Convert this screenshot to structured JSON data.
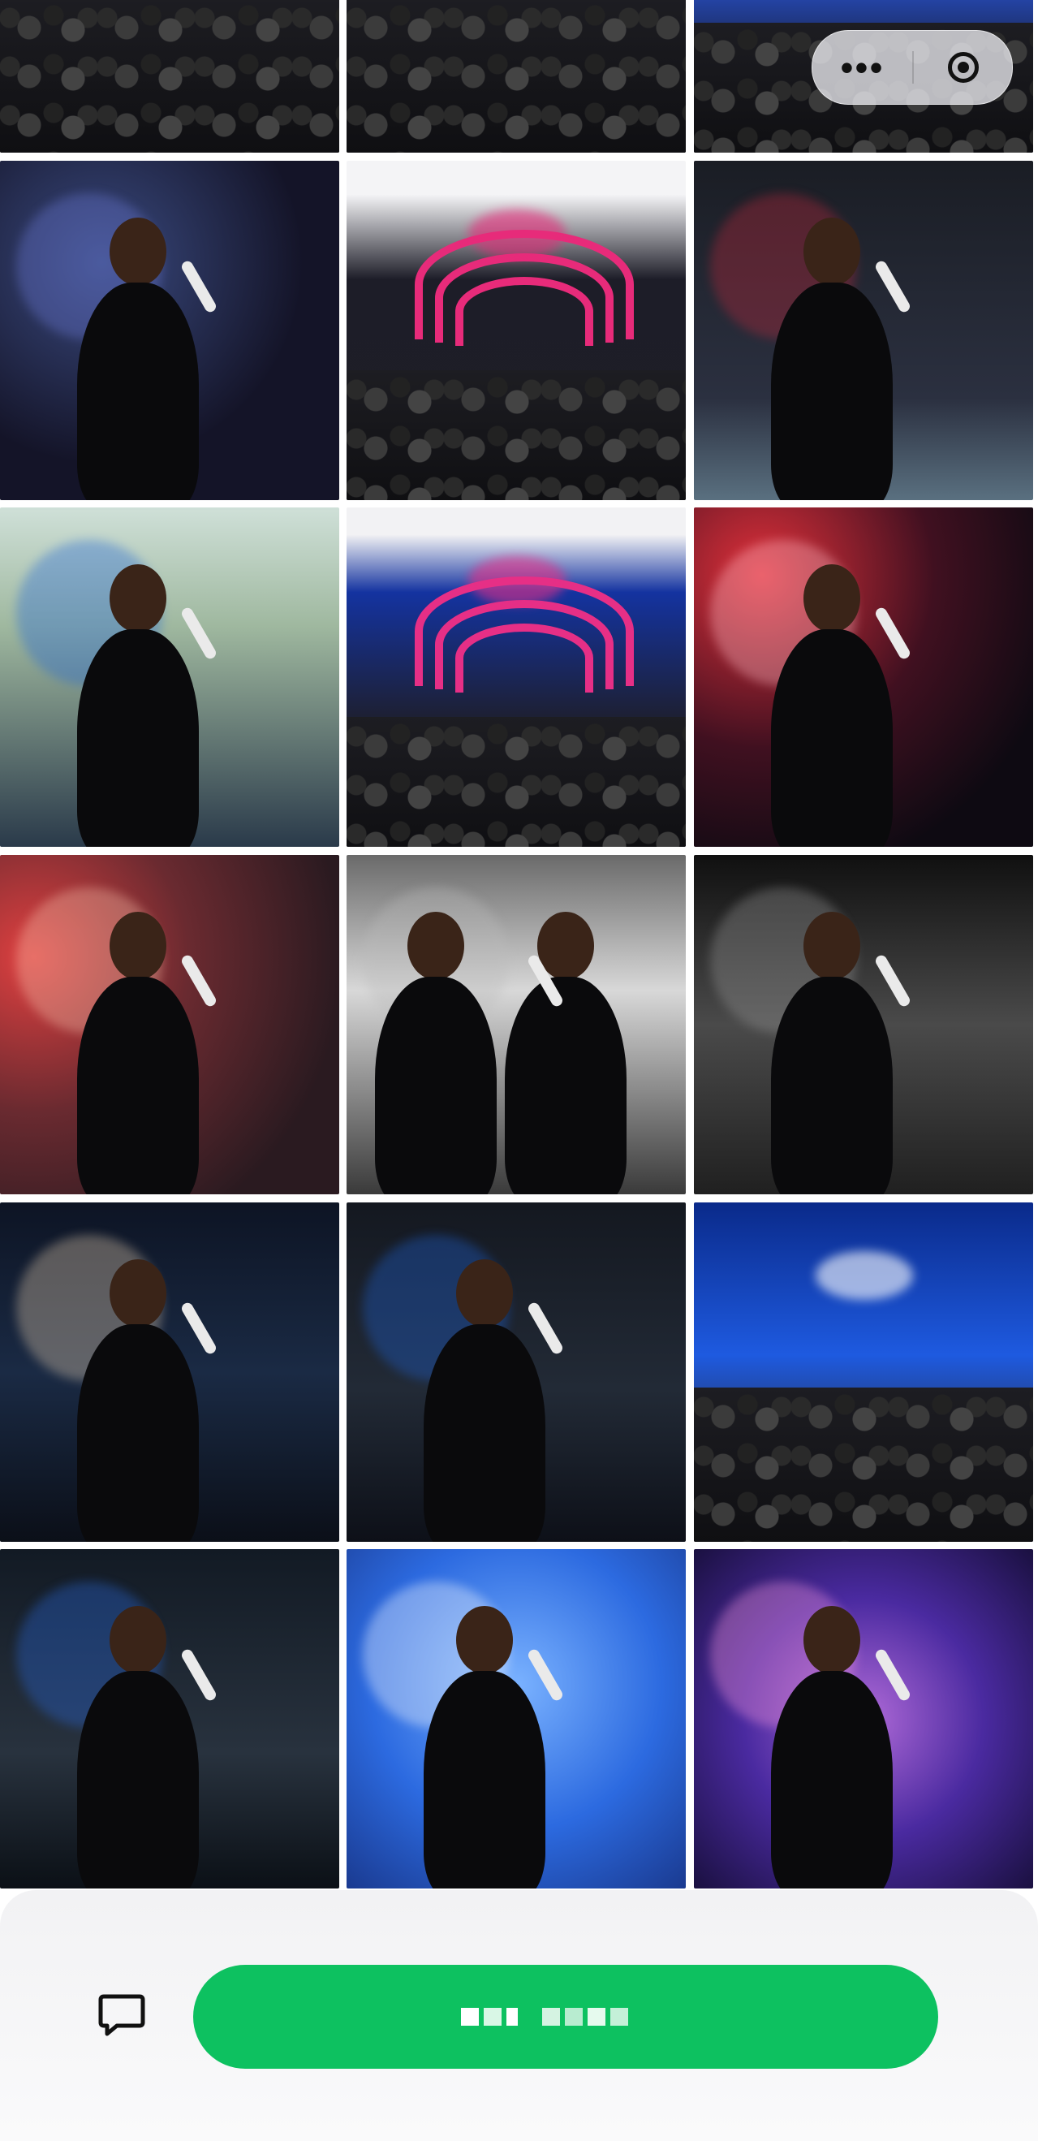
{
  "gallery": {
    "columns": 3,
    "photos": [
      {
        "id": 1,
        "subject": "crowd-stage-pink"
      },
      {
        "id": 2,
        "subject": "crowd-confetti-stage"
      },
      {
        "id": 3,
        "subject": "stage-pink-arch-blue-butterfly"
      },
      {
        "id": 4,
        "subject": "singer-black-dress-mic-down"
      },
      {
        "id": 5,
        "subject": "stage-pink-arches-crowd"
      },
      {
        "id": 6,
        "subject": "singer-black-dress-standing"
      },
      {
        "id": 7,
        "subject": "singer-back-blue-flowers"
      },
      {
        "id": 8,
        "subject": "stage-blue-butterfly-screen"
      },
      {
        "id": 9,
        "subject": "singer-red-light-closeup"
      },
      {
        "id": 10,
        "subject": "singer-closeup-mic"
      },
      {
        "id": 11,
        "subject": "singer-and-guitarist-bw"
      },
      {
        "id": 12,
        "subject": "singer-bw-flowers"
      },
      {
        "id": 13,
        "subject": "singer-side-profile-mic"
      },
      {
        "id": 14,
        "subject": "singer-blue-flowers-stage"
      },
      {
        "id": 15,
        "subject": "stage-blue-screen-wide"
      },
      {
        "id": 16,
        "subject": "singer-butterflies-arm-out"
      },
      {
        "id": 17,
        "subject": "singer-blue-backdrop-smiling"
      },
      {
        "id": 18,
        "subject": "singer-purple-lights"
      }
    ]
  },
  "top_capsule": {
    "more_icon": "more-dots-icon",
    "close_icon": "target-circle-icon"
  },
  "bottom_bar": {
    "comment_icon": "comment-bubble-icon",
    "primary_button_label": "",
    "primary_color": "#0dc160"
  }
}
